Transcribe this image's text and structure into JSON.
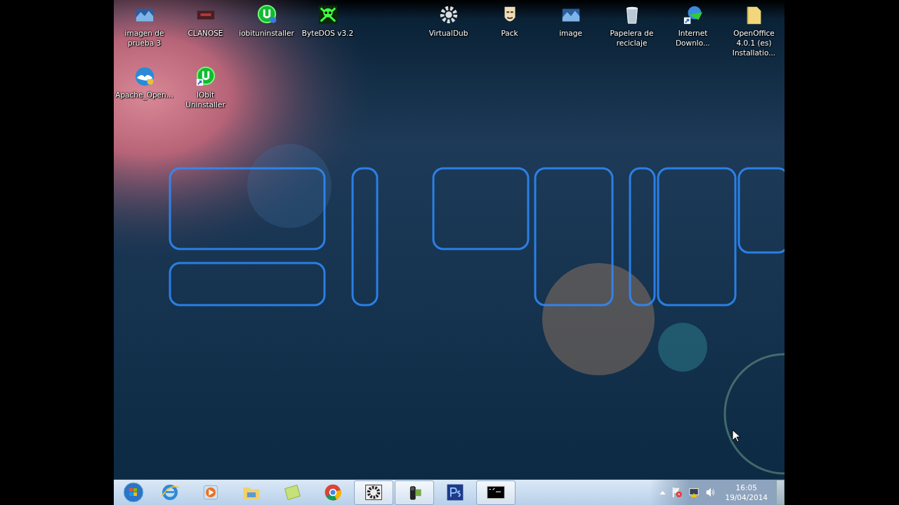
{
  "desktop": {
    "rows": [
      {
        "left": [
          {
            "kind": "photo",
            "label": "imagen de prueba 3"
          },
          {
            "kind": "banner",
            "label": "CLANOSE"
          },
          {
            "kind": "iobit-shield",
            "label": "iobituninstaller"
          },
          {
            "kind": "skull",
            "label": "ByteDOS v3.2"
          }
        ],
        "right": [
          {
            "kind": "gear",
            "label": "VirtualDub"
          },
          {
            "kind": "mask",
            "label": "Pack"
          },
          {
            "kind": "photo",
            "label": "image"
          },
          {
            "kind": "bin",
            "label": "Papelera de reciclaje"
          },
          {
            "kind": "globe-shortcut",
            "label": "Internet Downlo..."
          },
          {
            "kind": "folder",
            "label": "OpenOffice 4.0.1 (es) Installatio..."
          }
        ]
      },
      {
        "left": [
          {
            "kind": "gull",
            "label": "Apache_Open..."
          },
          {
            "kind": "iobit-shortcut",
            "label": "IObit Uninstaller"
          }
        ],
        "right": []
      }
    ]
  },
  "taskbar": {
    "items": [
      {
        "kind": "ie",
        "running": false
      },
      {
        "kind": "media",
        "running": false
      },
      {
        "kind": "folder",
        "running": false
      },
      {
        "kind": "note",
        "running": false
      },
      {
        "kind": "chrome",
        "running": false
      },
      {
        "kind": "gear",
        "running": true
      },
      {
        "kind": "camera",
        "running": true
      },
      {
        "kind": "ps",
        "running": false
      },
      {
        "kind": "cmd",
        "running": true
      }
    ],
    "tray": {
      "time": "16:05",
      "date": "19/04/2014"
    }
  }
}
